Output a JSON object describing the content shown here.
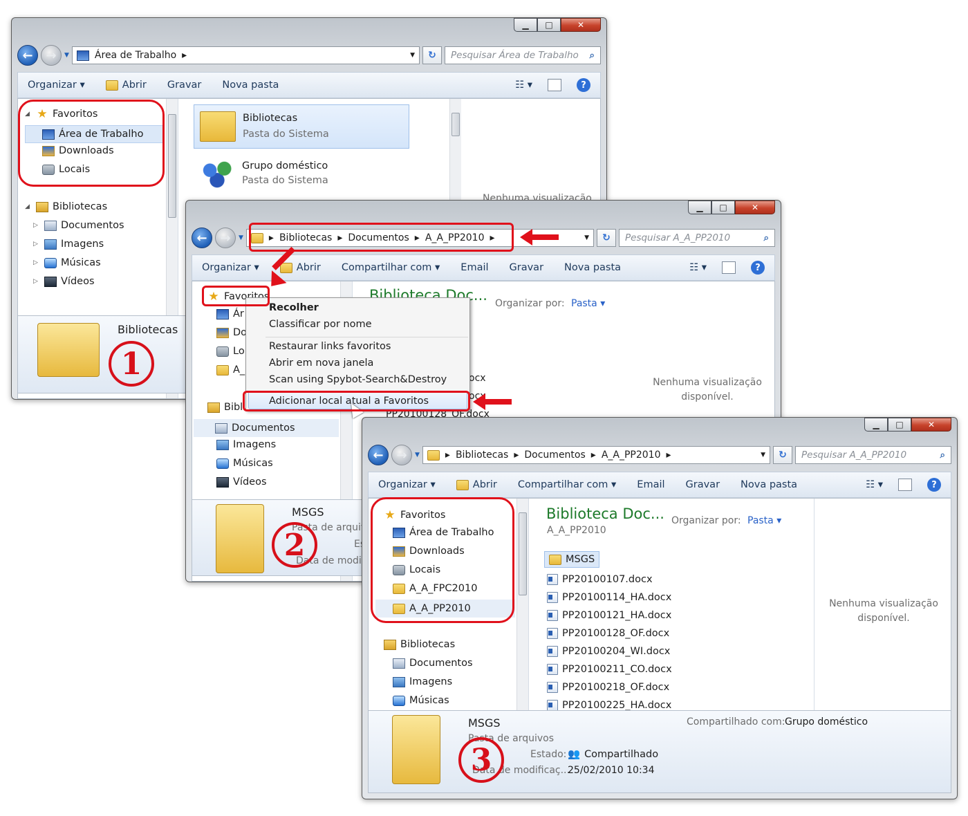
{
  "window1": {
    "address": [
      "Área de Trabalho"
    ],
    "search_placeholder": "Pesquisar Área de Trabalho",
    "toolbar": [
      "Organizar",
      "Abrir",
      "Gravar",
      "Nova pasta"
    ],
    "nav": {
      "favorites": "Favoritos",
      "fav_items": [
        "Área de Trabalho",
        "Downloads",
        "Locais"
      ],
      "libraries": "Bibliotecas",
      "lib_items": [
        "Documentos",
        "Imagens",
        "Músicas",
        "Vídeos"
      ]
    },
    "content": [
      {
        "name": "Bibliotecas",
        "sub": "Pasta do Sistema"
      },
      {
        "name": "Grupo doméstico",
        "sub": "Pasta do Sistema"
      }
    ],
    "preview_text": "Nenhuma visualização",
    "details_name": "Bibliotecas",
    "badge": "1"
  },
  "window2": {
    "address": [
      "Bibliotecas",
      "Documentos",
      "A_A_PP2010"
    ],
    "search_placeholder": "Pesquisar A_A_PP2010",
    "toolbar": [
      "Organizar",
      "Abrir",
      "Compartilhar com",
      "Email",
      "Gravar",
      "Nova pasta"
    ],
    "nav": {
      "favorites": "Favoritos",
      "partial_items": [
        "Ár",
        "Do",
        "Lo",
        "A_"
      ],
      "libraries": "Bibl",
      "lib_items": [
        "Documentos",
        "Imagens",
        "Músicas",
        "Vídeos"
      ]
    },
    "content_title": "Biblioteca Doc...",
    "arrange_label": "Organizar por:",
    "arrange_value": "Pasta",
    "partial_files": [
      "ocx",
      "ocx",
      "PP20100128_OF.docx"
    ],
    "preview_text": "Nenhuma visualização disponível.",
    "details": {
      "name": "MSGS",
      "type": "Pasta de arquiv",
      "state_partial": "Es",
      "date_partial": "Data de modif"
    },
    "context_menu": [
      "Recolher",
      "Classificar por nome",
      "Restaurar links favoritos",
      "Abrir em nova janela",
      "Scan using Spybot-Search&Destroy",
      "Adicionar local atual a Favoritos"
    ],
    "badge": "2"
  },
  "window3": {
    "address": [
      "Bibliotecas",
      "Documentos",
      "A_A_PP2010"
    ],
    "search_placeholder": "Pesquisar A_A_PP2010",
    "toolbar": [
      "Organizar",
      "Abrir",
      "Compartilhar com",
      "Email",
      "Gravar",
      "Nova pasta"
    ],
    "nav": {
      "favorites": "Favoritos",
      "fav_items": [
        "Área de Trabalho",
        "Downloads",
        "Locais",
        "A_A_FPC2010",
        "A_A_PP2010"
      ],
      "libraries": "Bibliotecas",
      "lib_items": [
        "Documentos",
        "Imagens",
        "Músicas"
      ]
    },
    "content_title": "Biblioteca Doc...",
    "content_subtitle": "A_A_PP2010",
    "arrange_label": "Organizar por:",
    "arrange_value": "Pasta",
    "folder": "MSGS",
    "files": [
      "PP20100107.docx",
      "PP20100114_HA.docx",
      "PP20100121_HA.docx",
      "PP20100128_OF.docx",
      "PP20100204_WI.docx",
      "PP20100211_CO.docx",
      "PP20100218_OF.docx",
      "PP20100225_HA.docx"
    ],
    "preview_text": "Nenhuma visualização disponível.",
    "details": {
      "name": "MSGS",
      "type": "Pasta de arquivos",
      "state_label": "Estado:",
      "state_value": "Compartilhado",
      "date_label": "Data de modificaç...",
      "date_value": "25/02/2010 10:34",
      "shared_label": "Compartilhado com:",
      "shared_value": "Grupo doméstico"
    },
    "badge": "3"
  },
  "colors": {
    "annotation": "#e0111b",
    "title_green": "#1d7a2a",
    "link": "#2a62c8"
  }
}
